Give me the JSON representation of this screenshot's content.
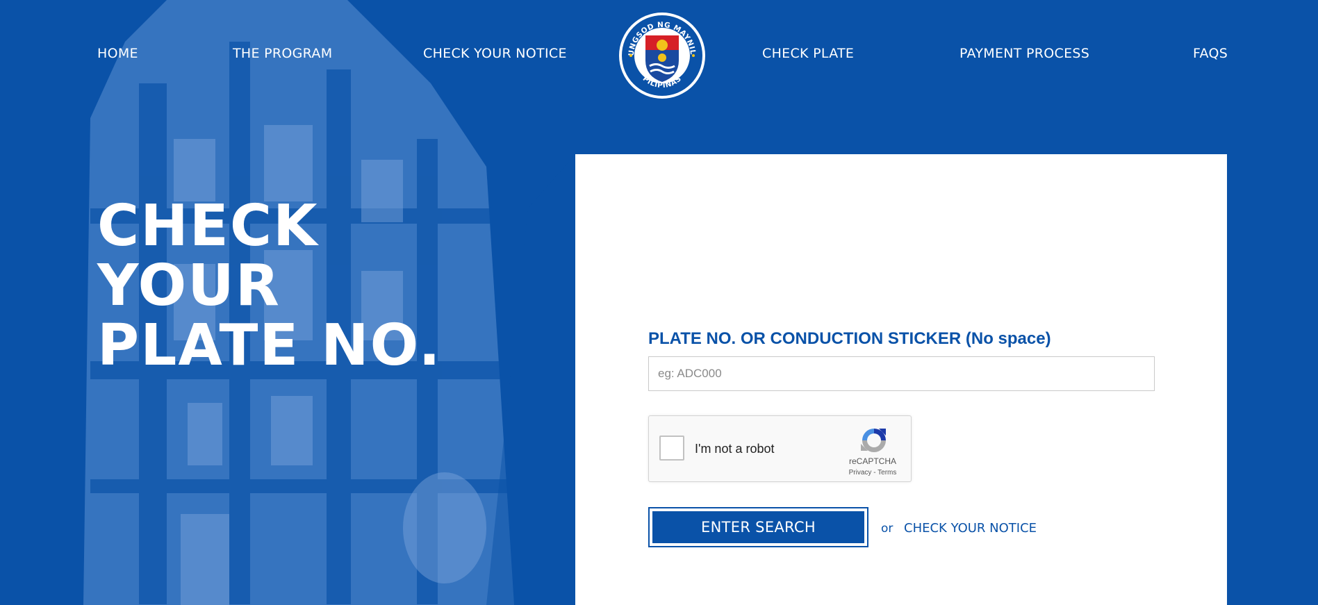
{
  "nav": {
    "items": [
      {
        "label": "HOME"
      },
      {
        "label": "THE PROGRAM"
      },
      {
        "label": "CHECK YOUR NOTICE"
      },
      {
        "label": "CHECK PLATE"
      },
      {
        "label": "PAYMENT PROCESS"
      },
      {
        "label": "FAQS"
      }
    ],
    "logo": {
      "icon": "city-seal-icon",
      "top_text": "LUNGSOD NG MAYNILA",
      "bottom_text": "PILIPINAS"
    }
  },
  "hero": {
    "title": "CHECK\nYOUR\nPLATE NO."
  },
  "form": {
    "plate_label": "PLATE NO. OR CONDUCTION STICKER (No space)",
    "plate_placeholder": "eg: ADC000",
    "plate_value": "",
    "recaptcha": {
      "label": "I'm not a robot",
      "brand": "reCAPTCHA",
      "privacy": "Privacy",
      "separator": " - ",
      "terms": "Terms",
      "checked": false
    },
    "search_button": "ENTER SEARCH",
    "or_text": "or",
    "notice_link": "CHECK YOUR NOTICE"
  },
  "colors": {
    "brand_blue": "#0a52a8",
    "background_light_blue": "#5b8fd1",
    "card_background": "#ffffff"
  }
}
